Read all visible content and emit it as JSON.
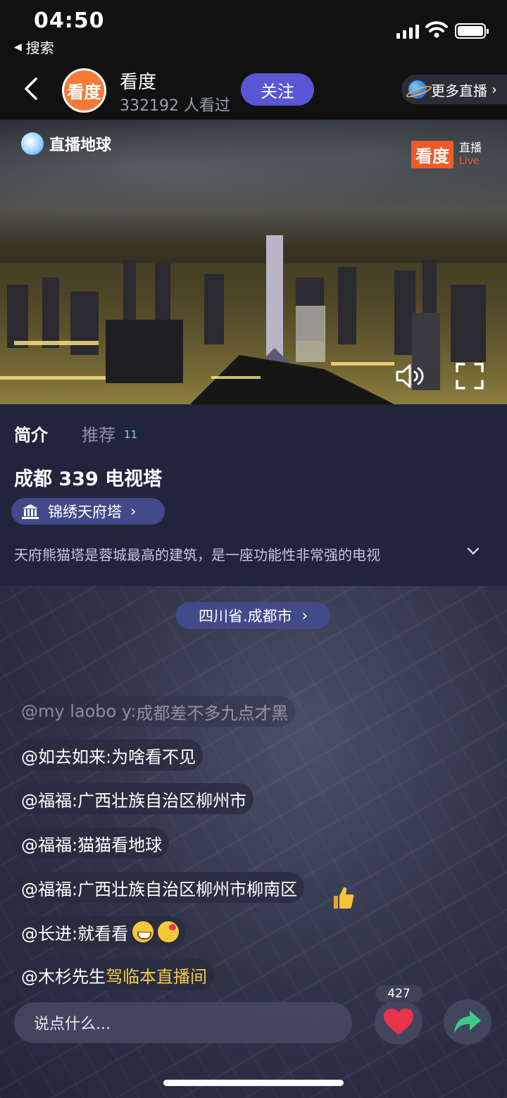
{
  "status_bar": {
    "time": "04:50",
    "back_app_label": "搜索"
  },
  "header": {
    "channel_name": "看度",
    "avatar_text": "看度",
    "viewers": "332192 人看过",
    "follow_label": "关注",
    "more_live_label": "更多直播",
    "more_live_chevron": "›"
  },
  "video": {
    "watermark_left": "直播地球",
    "watermark_right_badge": "看度",
    "watermark_right_text": "直播",
    "watermark_right_live": "Live"
  },
  "intro": {
    "tab_intro": "简介",
    "tab_recommend": "推荐",
    "tab_recommend_count": "11",
    "title": "成都 339 电视塔",
    "tag_label": "锦绣天府塔",
    "tag_chevron": "›",
    "description": "天府熊猫塔是蓉城最高的建筑，是一座功能性非常强的电视"
  },
  "location": {
    "label": "四川省.成都市",
    "chevron": "›"
  },
  "comments": [
    {
      "user": "@my laobo y:",
      "text": " 成都差不多九点才黑"
    },
    {
      "user": "@如去如来:",
      "text": " 为啥看不见"
    },
    {
      "user": "@福福:",
      "text": " 广西壮族自治区柳州市"
    },
    {
      "user": "@福福:",
      "text": " 猫猫看地球"
    },
    {
      "user": "@福福:",
      "text": " 广西壮族自治区柳州市柳南区"
    },
    {
      "user": "@长进:",
      "text": " 就看看"
    },
    {
      "user": "@木杉先生",
      "text": " 驾临本直播间"
    }
  ],
  "bottom": {
    "input_placeholder": "说点什么...",
    "like_count": "427"
  },
  "colors": {
    "accent": "#5a56d6",
    "tag_bg": "#434a8a",
    "panel_bg": "#20243c",
    "like": "#e8334a",
    "share": "#3ec98b",
    "highlight": "#f5c94a"
  }
}
